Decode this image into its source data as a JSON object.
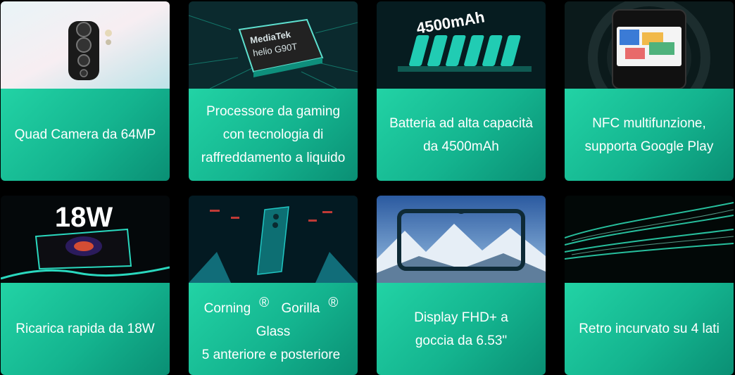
{
  "cards": [
    {
      "caption": "Quad Camera da 64MP",
      "icon": "camera-module-image"
    },
    {
      "caption": "Processore da gaming\ncon tecnologia di\nraffreddamento a liquido",
      "chip_brand": "MediaTek",
      "chip_model": "helio G90T",
      "icon": "processor-chip-image"
    },
    {
      "caption": "Batteria ad alta capacità\nda 4500mAh",
      "battery_label": "4500mAh",
      "icon": "battery-cells-image"
    },
    {
      "caption": "NFC multifunzione,\nsupporta Google Play",
      "icon": "phone-payment-image"
    },
    {
      "caption": "Ricarica rapida da 18W",
      "charge_label": "18W",
      "icon": "fast-charge-image"
    },
    {
      "caption_part1": "Corning",
      "caption_part2": " Gorilla",
      "caption_part3": " Glass\n5 anteriore e posteriore",
      "reg_mark": "®",
      "icon": "gorilla-glass-phone-image"
    },
    {
      "caption": "Display FHD+ a\ngoccia da 6.53\"",
      "icon": "display-phone-image"
    },
    {
      "caption": "Retro incurvato su 4 lati",
      "icon": "curved-back-image"
    }
  ],
  "colors": {
    "accent_start": "#22d3a5",
    "accent_end": "#0a8f74",
    "background": "#000000"
  }
}
